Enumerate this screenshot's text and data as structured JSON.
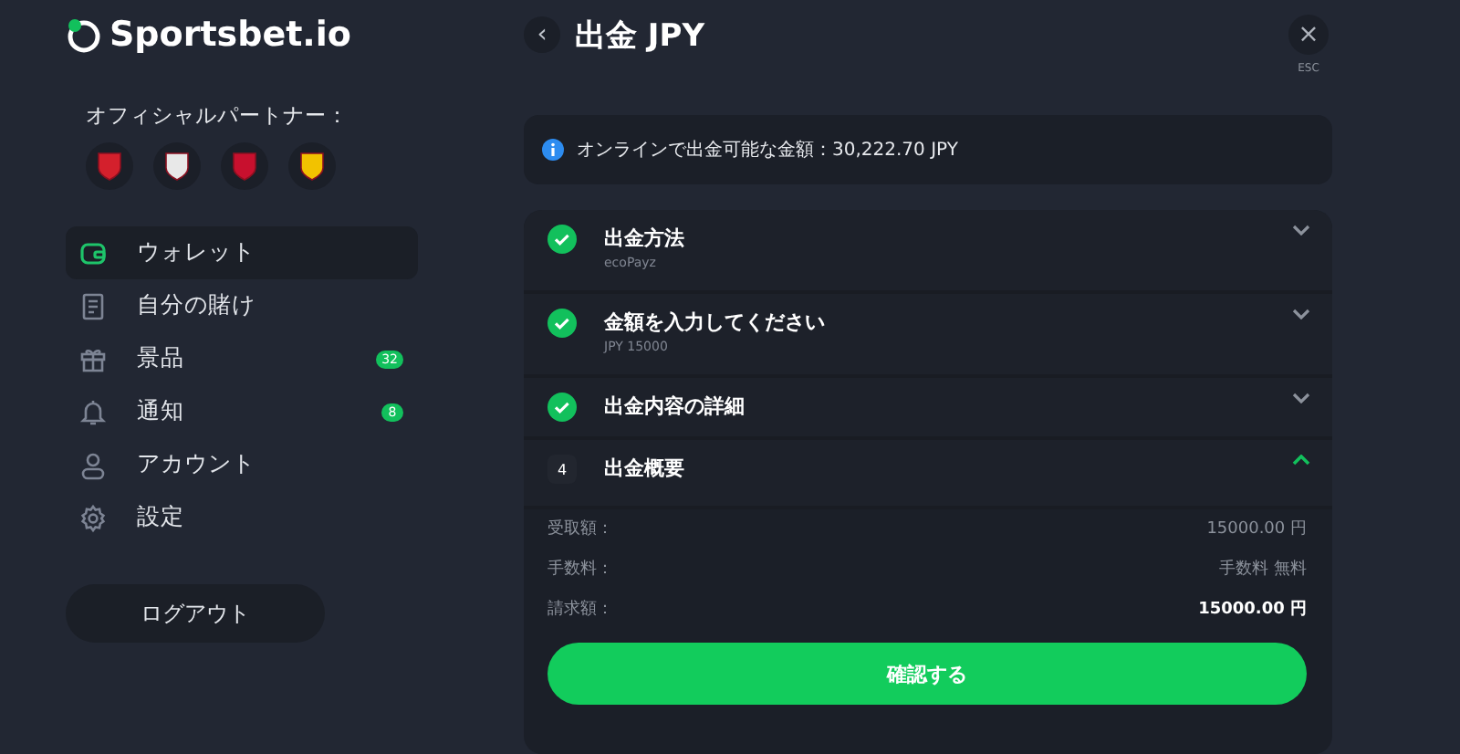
{
  "sidebar": {
    "logo": "Sportsbet.io",
    "partners_label": "オフィシャルパートナー：",
    "nav": [
      {
        "label": "ウォレット",
        "kind": "wallet",
        "selected": true
      },
      {
        "label": "自分の賭け",
        "kind": "slip",
        "selected": false
      },
      {
        "label": "景品",
        "kind": "gift",
        "selected": false,
        "badge": "32"
      },
      {
        "label": "通知",
        "kind": "bell",
        "selected": false,
        "badge": "8"
      },
      {
        "label": "アカウント",
        "kind": "user",
        "selected": false
      },
      {
        "label": "設定",
        "kind": "gear",
        "selected": false
      }
    ],
    "logout": "ログアウト"
  },
  "header": {
    "back": "‹",
    "title": "出金 JPY",
    "close": "×",
    "close_hint": "ESC"
  },
  "info": "オンラインで出金可能な金額：30,222.70 JPY",
  "steps": [
    {
      "kind": "done",
      "title": "出金方法",
      "subtitle": "ecoPayz",
      "expanded": false
    },
    {
      "kind": "done",
      "title": "金額を入力してください",
      "subtitle": "JPY 15000",
      "expanded": false
    },
    {
      "kind": "done",
      "title": "出金内容の詳細",
      "expanded": false
    },
    {
      "kind": "numbered",
      "number": "4",
      "title": "出金概要",
      "expanded": true
    }
  ],
  "summary": [
    {
      "label": "受取額：",
      "value": "15000.00 円",
      "emphasis": false
    },
    {
      "label": "手数料：",
      "value": "手数料 無料",
      "emphasis": false
    },
    {
      "label": "請求額：",
      "value": "15000.00 円",
      "emphasis": true
    }
  ],
  "confirm": "確認する"
}
